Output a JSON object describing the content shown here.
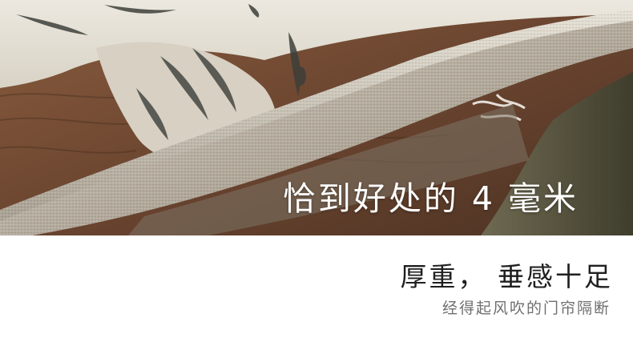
{
  "photo": {
    "overlay_caption": "恰到好处的 4 毫米"
  },
  "text_block": {
    "headline": "厚重，  垂感十足",
    "subline": "经得起风吹的门帘隔断"
  },
  "colors": {
    "wood": "#6b4a34",
    "fabric": "#d8d2c6",
    "fabric_shadow": "#a39a8c",
    "print_dark": "#3d3f3a",
    "headline": "#1f1f1f",
    "subline": "#6f6f6f"
  }
}
